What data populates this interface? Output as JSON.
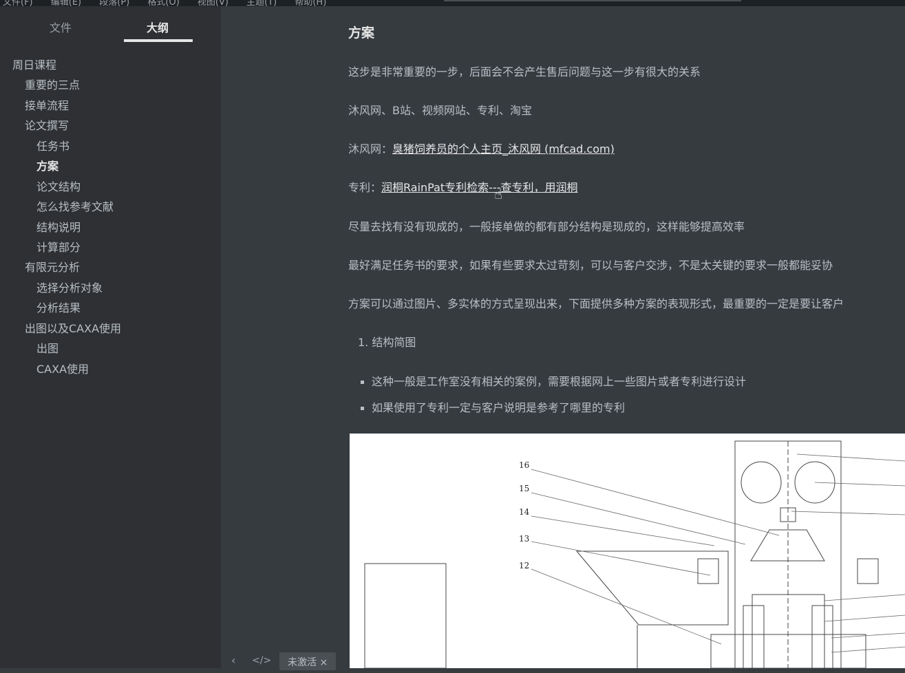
{
  "menubar": {
    "items": [
      "文件(F)",
      "编辑(E)",
      "段落(P)",
      "格式(O)",
      "视图(V)",
      "主题(T)",
      "帮助(H)"
    ]
  },
  "sidebar": {
    "tabs": {
      "files": "文件",
      "outline": "大纲"
    },
    "outline": [
      {
        "label": "周日课程",
        "level": 0
      },
      {
        "label": "重要的三点",
        "level": 1
      },
      {
        "label": "接单流程",
        "level": 1
      },
      {
        "label": "论文撰写",
        "level": 1
      },
      {
        "label": "任务书",
        "level": 2
      },
      {
        "label": "方案",
        "level": 2,
        "active": true
      },
      {
        "label": "论文结构",
        "level": 2
      },
      {
        "label": "怎么找参考文献",
        "level": 2
      },
      {
        "label": "结构说明",
        "level": 2
      },
      {
        "label": "计算部分",
        "level": 2
      },
      {
        "label": "有限元分析",
        "level": 1
      },
      {
        "label": "选择分析对象",
        "level": 2
      },
      {
        "label": "分析结果",
        "level": 2
      },
      {
        "label": "出图以及CAXA使用",
        "level": 1
      },
      {
        "label": "出图",
        "level": 2
      },
      {
        "label": "CAXA使用",
        "level": 2
      }
    ]
  },
  "footer": {
    "prev_icon": "‹",
    "source_icon": "</>",
    "status_chip": "未激活 ×"
  },
  "content": {
    "heading": "方案",
    "para1": "这步是非常重要的一步，后面会不会产生售后问题与这一步有很大的关系",
    "para2": "沐风网、B站、视频网站、专利、淘宝",
    "para3_prefix": "沐风网：",
    "para3_link": "臭猪饲养员的个人主页_沐风网 (mfcad.com)",
    "para4_prefix": "专利：",
    "para4_link": "润桐RainPat专利检索---查专利，用润桐",
    "para5": "尽量去找有没有现成的，一般接单做的都有部分结构是现成的，这样能够提高效率",
    "para6": "最好满足任务书的要求，如果有些要求太过苛刻，可以与客户交涉，不是太关键的要求一般都能妥协",
    "para7": "方案可以通过图片、多实体的方式呈现出来，下面提供多种方案的表现形式，最重要的一定是要让客户",
    "ol_item1": "1. 结构简图",
    "ul_items": [
      "这种一般是工作室没有相关的案例，需要根据网上一些图片或者专利进行设计",
      "如果使用了专利一定与客户说明是参考了哪里的专利"
    ]
  },
  "figure": {
    "labels": [
      "16",
      "15",
      "14",
      "13",
      "12"
    ]
  }
}
